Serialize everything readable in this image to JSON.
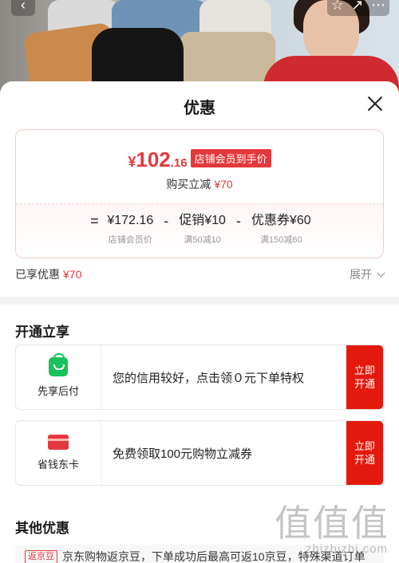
{
  "banner": {
    "back_icon": "chevron-left-icon",
    "actions": [
      "star-icon",
      "share-icon",
      "more-icon"
    ]
  },
  "sheet": {
    "title": "优惠",
    "close_icon": "close-icon"
  },
  "price_card": {
    "yen": "¥",
    "price_int": "102",
    "price_dec": ".16",
    "tag": "店铺会员到手价",
    "buy_reduce_label": "购买立减",
    "buy_reduce_amount": "¥70",
    "formula": {
      "equals": "=",
      "minus": "-",
      "items": [
        {
          "value": "¥172.16",
          "sub": "店铺会员价"
        },
        {
          "value": "促销¥10",
          "sub": "满50减10"
        },
        {
          "value": "优惠券¥60",
          "sub": "满150减60"
        }
      ]
    }
  },
  "enjoy": {
    "label": "已享优惠",
    "amount": "¥70",
    "expand_label": "展开"
  },
  "open_section": {
    "title": "开通立享",
    "cards": [
      {
        "icon": "shopping-bag-icon",
        "label": "先享后付",
        "desc": "您的信用较好，点击领０元下单特权",
        "button": "立即\n开通"
      },
      {
        "icon": "card-icon",
        "label": "省钱东卡",
        "desc": "免费领取100元购物立减券",
        "button": "立即\n开通"
      }
    ]
  },
  "other_section": {
    "title": "其他优惠",
    "badge": "返京豆",
    "text": "京东购物返京豆，下单成功后最高可返10京豆，特殊渠道订单"
  },
  "watermark": {
    "main": "值值值",
    "sub": "zhizhizhi.com"
  },
  "colors": {
    "accent": "#e4393c",
    "button": "#e4190d",
    "green": "#19c15a"
  }
}
